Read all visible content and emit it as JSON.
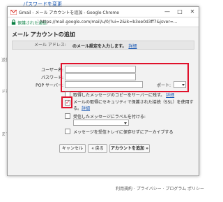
{
  "background": {
    "password_link": "パスワードを変更",
    "fragments": [
      "送信し",
      "ドを",
      "ます"
    ],
    "footer": "利用規約 · プライバシー · プログラム ポリシー"
  },
  "window": {
    "title": "Gmail - メール アカウントを追加 - Google Chrome",
    "controls": {
      "minimize": "—",
      "maximize": "□",
      "close": "✕"
    },
    "secure_label": "保護された通信",
    "url": "https://mail.google.com/mail/u/0/?ui=2&ik=b3ee0d3ff7&jsver=..."
  },
  "dialog": {
    "heading": "メール アカウントの追加",
    "instruction": "のメール設定を入力します。",
    "instruction_link": "詳細",
    "section_title": "メール アドレス:",
    "fields": {
      "username": {
        "label": "ユーザー名:",
        "value": ""
      },
      "password": {
        "label": "パスワード:",
        "value": ""
      },
      "pop_server": {
        "label": "POP サーバー:",
        "value": ""
      }
    },
    "port_label": "ポート:",
    "port_value": "",
    "options": {
      "keep_copy": {
        "text": "取得したメッセージのコピーをサーバーに残す。",
        "link": "詳細",
        "checked": false
      },
      "use_ssl": {
        "text": "メールの取得にセキュリティで保護された接続（SSL）を使用す",
        "text2": "る。",
        "link": "詳細",
        "checked": true
      },
      "apply_label": {
        "text": "受信したメッセージにラベルを付ける:",
        "checked": false
      },
      "archive": {
        "text": "メッセージを受信トレイに保存せずにアーカイブする",
        "checked": false
      }
    },
    "buttons": {
      "cancel": "キャンセル",
      "back": "« 戻る",
      "add": "アカウントを追加 »"
    },
    "highlight_color": "#e0112b"
  }
}
